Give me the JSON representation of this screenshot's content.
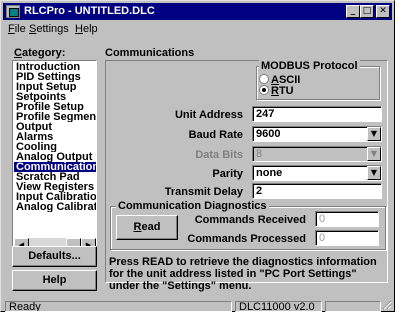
{
  "window": {
    "title": "RLCPro - UNTITLED.DLC",
    "minimize_glyph": "_",
    "maximize_glyph": "□",
    "close_glyph": "✕"
  },
  "menu": [
    {
      "label": "File",
      "accel": "F",
      "rest": "ile"
    },
    {
      "label": "Settings",
      "accel": "S",
      "rest": "ettings"
    },
    {
      "label": "Help",
      "accel": "H",
      "rest": "elp"
    }
  ],
  "sidebar": {
    "label": "Category:",
    "items": [
      "Introduction",
      "PID Settings",
      "Input Setup",
      "Setpoints",
      "Profile Setup",
      "Profile Segments",
      "Output",
      "Alarms",
      "Cooling",
      "Analog Output",
      "Communications",
      "Scratch Pad",
      "View Registers",
      "Input Calibration",
      "Analog Calibration"
    ],
    "selected_index": 10,
    "scroll_left_glyph": "◀",
    "scroll_right_glyph": "▶",
    "defaults_button": "Defaults...",
    "help_button": "Help"
  },
  "panel": {
    "title": "Communications",
    "protocol": {
      "group_title": "MODBUS Protocol",
      "options": [
        {
          "accel": "A",
          "rest": "SCII",
          "checked": false
        },
        {
          "accel": "R",
          "rest": "TU",
          "checked": true
        }
      ]
    },
    "fields": {
      "unit_address": {
        "label": "Unit Address",
        "value": "247"
      },
      "baud_rate": {
        "label": "Baud Rate",
        "value": "9600"
      },
      "data_bits": {
        "label": "Data Bits",
        "value": "8"
      },
      "parity": {
        "label": "Parity",
        "value": "none"
      },
      "transmit_delay": {
        "label": "Transmit Delay",
        "value": "2"
      }
    },
    "combo_arrow_glyph": "▼",
    "diagnostics": {
      "group_title": "Communication Diagnostics",
      "read_button": {
        "accel": "R",
        "rest": "ead"
      },
      "commands_received": {
        "label": "Commands Received",
        "value": "0"
      },
      "commands_processed": {
        "label": "Commands Processed",
        "value": "0"
      }
    },
    "info": "Press READ to retrieve the diagnostics information for the unit address listed in \"PC Port Settings\" under the \"Settings\" menu."
  },
  "statusbar": {
    "status": "Ready",
    "version": "DLC11000 v2.0"
  }
}
